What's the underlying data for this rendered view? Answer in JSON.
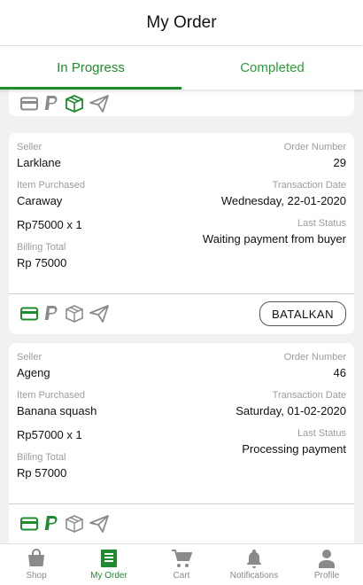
{
  "header": {
    "title": "My Order"
  },
  "tabs": [
    {
      "label": "In Progress",
      "active": true
    },
    {
      "label": "Completed",
      "active": false
    }
  ],
  "orders": [
    {
      "seller_label": "Seller",
      "seller": "Larklane",
      "order_number_label": "Order Number",
      "order_number": "29",
      "item_label": "Item Purchased",
      "item": "Caraway",
      "date_label": "Transaction Date",
      "date": "Wednesday, 22-01-2020",
      "qty_price": "Rp75000 x 1",
      "status_label": "Last Status",
      "status": "Waiting payment from buyer",
      "billing_label": "Billing Total",
      "billing": "Rp 75000",
      "active_step": "payment",
      "cancel_label": "BATALKAN"
    },
    {
      "seller_label": "Seller",
      "seller": "Ageng",
      "order_number_label": "Order Number",
      "order_number": "46",
      "item_label": "Item Purchased",
      "item": "Banana squash",
      "date_label": "Transaction Date",
      "date": "Saturday, 01-02-2020",
      "qty_price": "Rp57000 x 1",
      "status_label": "Last Status",
      "status": "Processing payment",
      "billing_label": "Billing Total",
      "billing": "Rp 57000",
      "active_step": "paypal"
    }
  ],
  "status_icons": [
    "card-icon",
    "paypal-icon",
    "package-icon",
    "send-icon"
  ],
  "nav": [
    {
      "label": "Shop",
      "icon": "shopping-bag-icon",
      "active": false
    },
    {
      "label": "My Order",
      "icon": "order-list-icon",
      "active": true
    },
    {
      "label": "Cart",
      "icon": "cart-icon",
      "active": false
    },
    {
      "label": "Notifications",
      "icon": "bell-icon",
      "active": false
    },
    {
      "label": "Profile",
      "icon": "person-icon",
      "active": false
    }
  ],
  "colors": {
    "accent": "#1f8a30",
    "inactive_icon": "#8a8a8a"
  }
}
